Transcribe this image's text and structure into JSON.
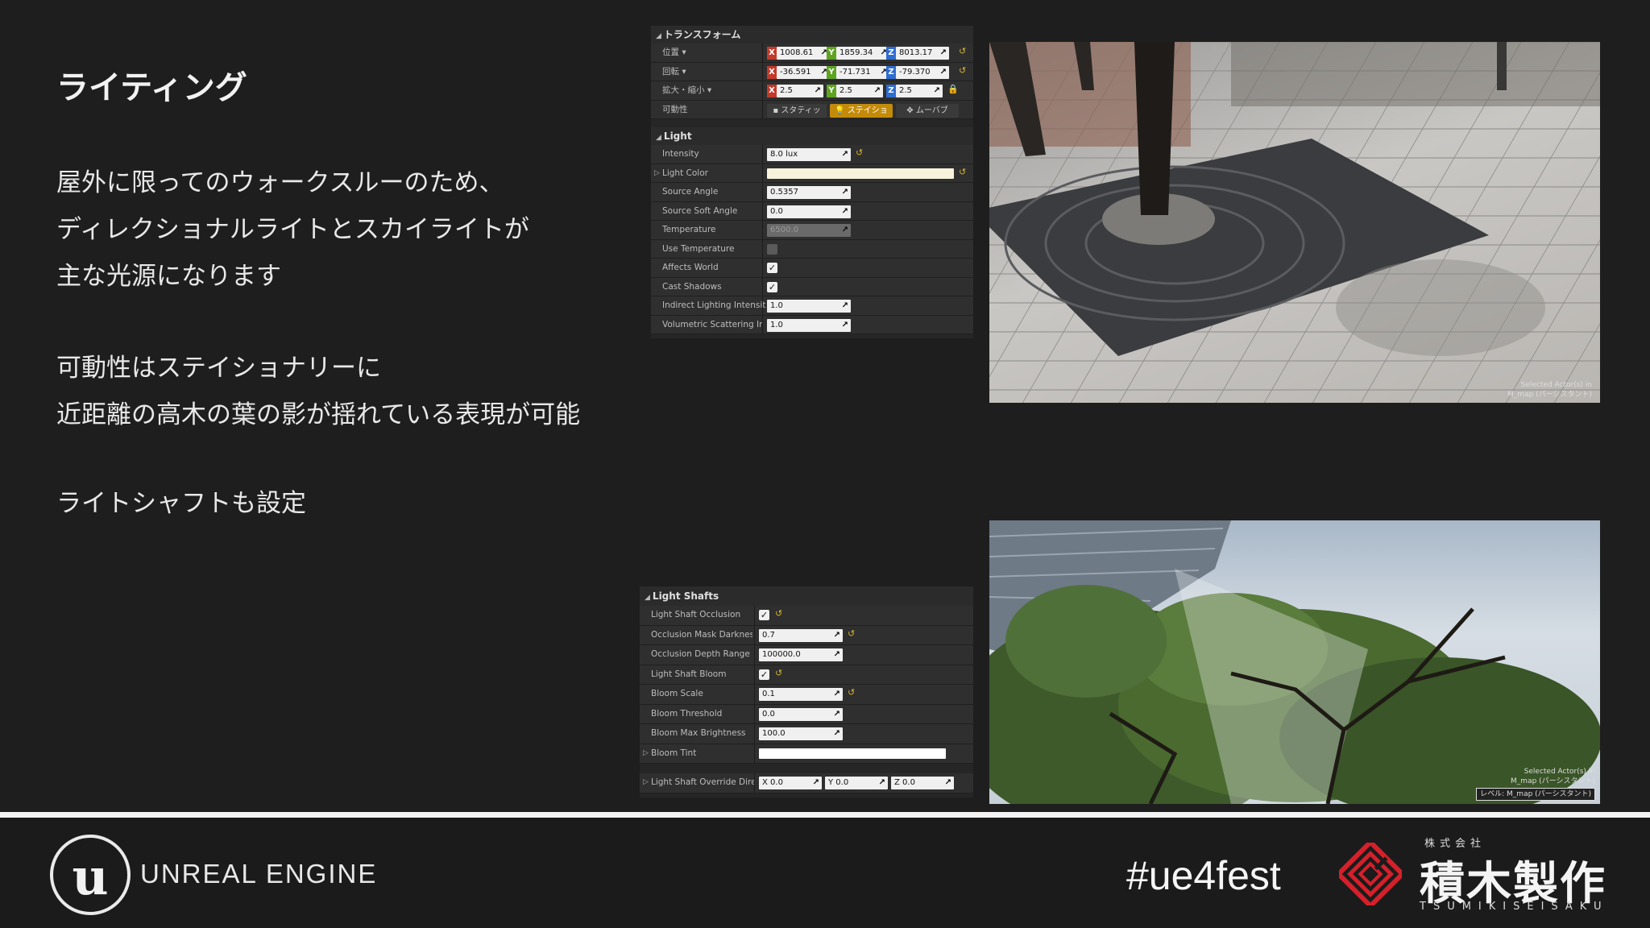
{
  "slide": {
    "title": "ライティング",
    "para1": [
      "屋外に限ってのウォークスルーのため、",
      "ディレクショナルライトとスカイライトが",
      "主な光源になります"
    ],
    "para2": [
      "可動性はステイショナリーに",
      "近距離の高木の葉の影が揺れている表現が可能"
    ],
    "para3": [
      "ライトシャフトも設定"
    ]
  },
  "transform_panel": {
    "section": "トランスフォーム",
    "location_label": "位置 ▾",
    "rotation_label": "回転 ▾",
    "scale_label": "拡大・縮小 ▾",
    "mobility_label": "可動性",
    "location": {
      "x": "1008.61",
      "y": "1859.34",
      "z": "8013.17"
    },
    "rotation": {
      "x": "-36.591",
      "y": "-71.731",
      "z": "-79.370"
    },
    "scale": {
      "x": "2.5",
      "y": "2.5",
      "z": "2.5"
    },
    "mobility": {
      "static": "スタティッ",
      "stationary": "ステイショ",
      "movable": "ムーバブ"
    }
  },
  "light_panel": {
    "section": "Light",
    "props": [
      {
        "label": "Intensity",
        "value": "8.0 lux"
      },
      {
        "label": "Light Color",
        "value": ""
      },
      {
        "label": "Source Angle",
        "value": "0.5357"
      },
      {
        "label": "Source Soft Angle",
        "value": "0.0"
      },
      {
        "label": "Temperature",
        "value": "6500.0"
      },
      {
        "label": "Use Temperature",
        "value": ""
      },
      {
        "label": "Affects World",
        "value": ""
      },
      {
        "label": "Cast Shadows",
        "value": ""
      },
      {
        "label": "Indirect Lighting Intensity",
        "value": "1.0"
      },
      {
        "label": "Volumetric Scattering Int",
        "value": "1.0"
      }
    ],
    "light_color": "#f6f2dc"
  },
  "shafts_panel": {
    "section": "Light Shafts",
    "props": [
      {
        "label": "Light Shaft Occlusion",
        "value": ""
      },
      {
        "label": "Occlusion Mask Darknes",
        "value": "0.7"
      },
      {
        "label": "Occlusion Depth Range",
        "value": "100000.0"
      },
      {
        "label": "Light Shaft Bloom",
        "value": ""
      },
      {
        "label": "Bloom Scale",
        "value": "0.1"
      },
      {
        "label": "Bloom Threshold",
        "value": "0.0"
      },
      {
        "label": "Bloom Max Brightness",
        "value": "100.0"
      },
      {
        "label": "Bloom Tint",
        "value": ""
      },
      {
        "label": "Light Shaft Override Dire",
        "value": ""
      }
    ],
    "override": {
      "x": "0.0",
      "y": "0.0",
      "z": "0.0"
    },
    "bloom_tint": "#ffffff"
  },
  "viewports": {
    "top_stamp": [
      "Selected Actor(s) in",
      "M_map (パーシスタント)"
    ],
    "bottom_stamp": [
      "Selected Actor(s) in",
      "M_map (パーシスタント)",
      "レベル: M_map (パーシスタント)"
    ]
  },
  "footer": {
    "engine_name": "UNREAL ENGINE",
    "engine_glyph": "u",
    "hashtag": "#ue4fest",
    "company_prefix": "株式会社",
    "company_name": "積木製作",
    "company_roman": "TSUMIKISEISAKU"
  },
  "colors": {
    "accent_orange": "#c48b0a",
    "axis_x": "#c23a2a",
    "axis_y": "#5ea421",
    "axis_z": "#2f6cd0",
    "company_red": "#d4202a"
  }
}
